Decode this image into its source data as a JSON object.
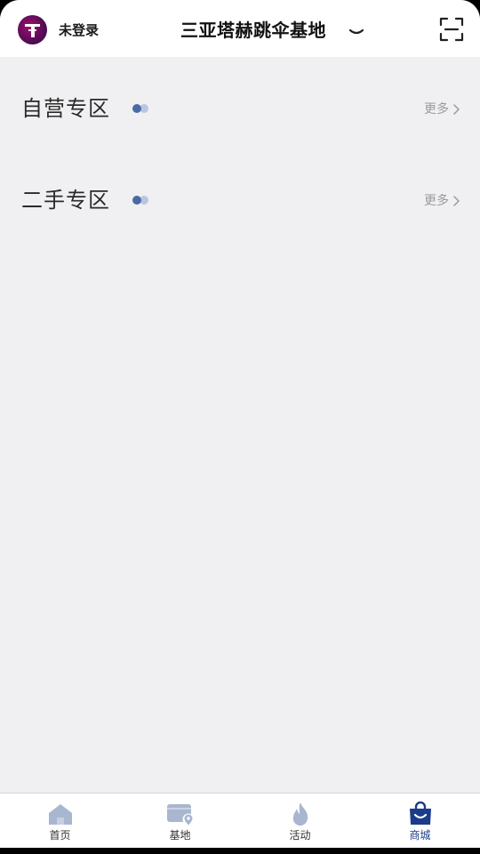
{
  "header": {
    "login_status": "未登录",
    "base_name": "三亚塔赫跳伞基地",
    "icons": {
      "avatar": "skydive-logo-avatar",
      "dropdown": "chevron-down-icon",
      "scan": "scan-icon"
    }
  },
  "sections": [
    {
      "title": "自营专区",
      "more_label": "更多"
    },
    {
      "title": "二手专区",
      "more_label": "更多"
    }
  ],
  "bottom_nav": {
    "active_index": 3,
    "active_color": "#1a3c8a",
    "inactive_icon_color": "#a9b6cf",
    "items": [
      {
        "label": "首页",
        "icon": "home-icon"
      },
      {
        "label": "基地",
        "icon": "base-location-icon"
      },
      {
        "label": "活动",
        "icon": "flame-icon"
      },
      {
        "label": "商城",
        "icon": "shopping-bag-icon"
      }
    ]
  }
}
